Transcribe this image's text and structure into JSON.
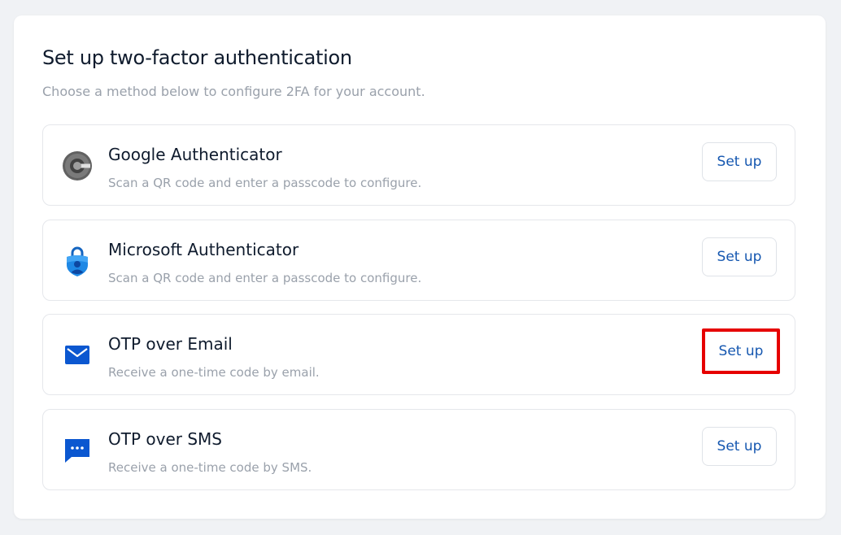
{
  "header": {
    "title": "Set up two-factor authentication",
    "subtitle": "Choose a method below to configure 2FA for your account."
  },
  "methods": [
    {
      "title": "Google Authenticator",
      "description": "Scan a QR code and enter a passcode to configure.",
      "button_label": "Set up",
      "icon": "google-authenticator-icon"
    },
    {
      "title": "Microsoft Authenticator",
      "description": "Scan a QR code and enter a passcode to configure.",
      "button_label": "Set up",
      "icon": "microsoft-authenticator-icon"
    },
    {
      "title": "OTP over Email",
      "description": "Receive a one-time code by email.",
      "button_label": "Set up",
      "icon": "mail-icon",
      "highlighted": true
    },
    {
      "title": "OTP over SMS",
      "description": "Receive a one-time code by SMS.",
      "button_label": "Set up",
      "icon": "sms-chat-icon"
    }
  ],
  "colors": {
    "accent": "#1557b0",
    "highlight": "#e60000",
    "icon_blue": "#0b57d0"
  }
}
